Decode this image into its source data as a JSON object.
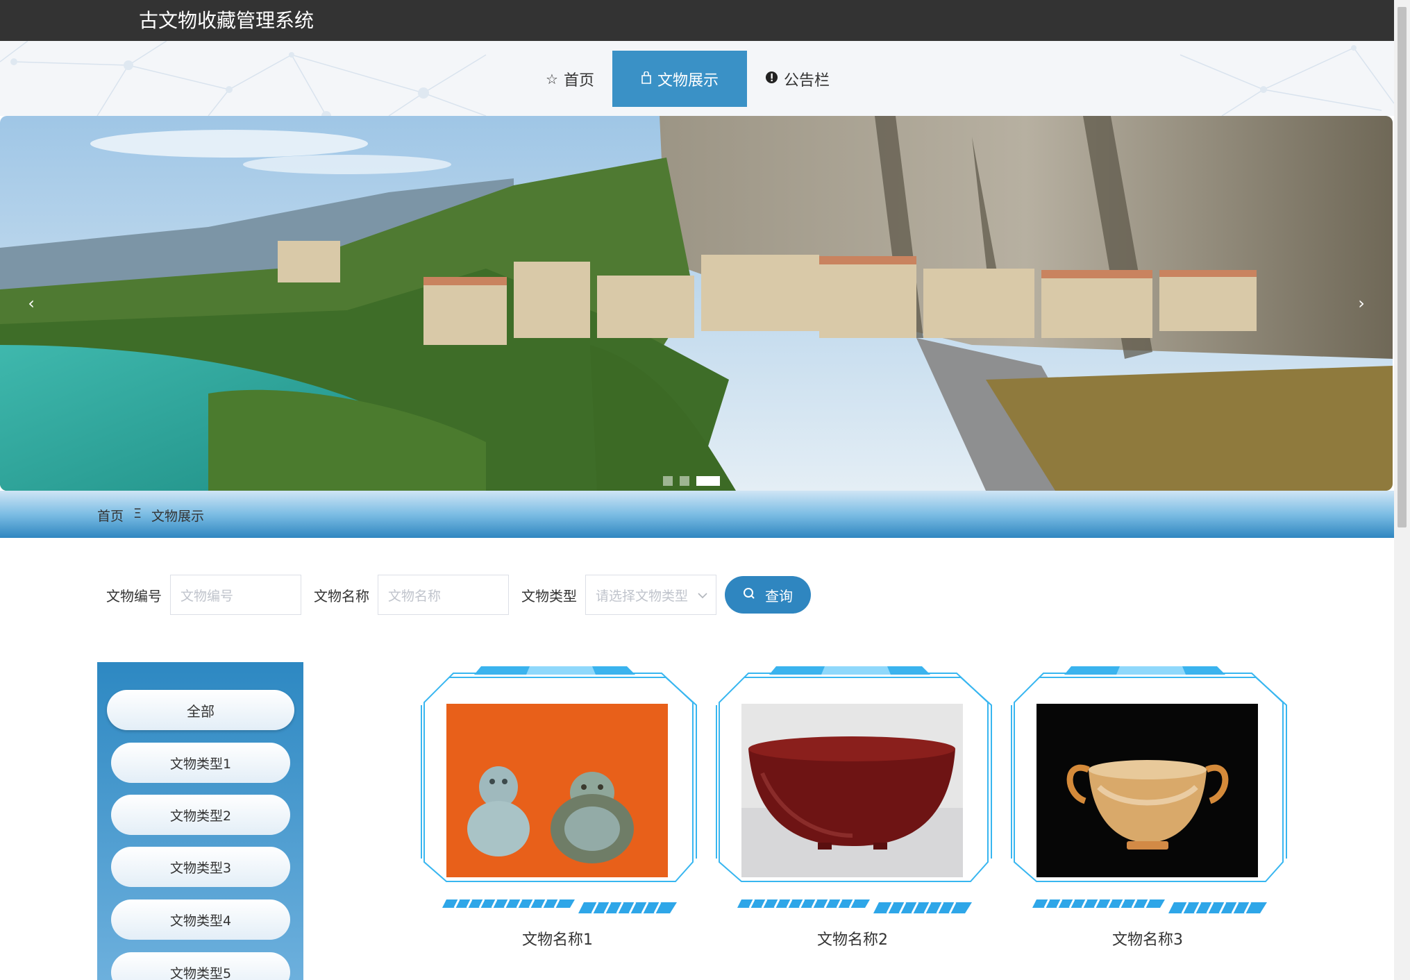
{
  "app": {
    "title": "古文物收藏管理系统"
  },
  "nav": {
    "items": [
      {
        "label": "首页",
        "icon": "star-icon"
      },
      {
        "label": "文物展示",
        "icon": "bag-icon",
        "active": true
      },
      {
        "label": "公告栏",
        "icon": "alert-icon"
      }
    ]
  },
  "carousel": {
    "slide_count": 3,
    "active_index": 2
  },
  "breadcrumb": {
    "home": "首页",
    "separator": "Ξ",
    "current": "文物展示"
  },
  "search": {
    "code_label": "文物编号",
    "code_placeholder": "文物编号",
    "name_label": "文物名称",
    "name_placeholder": "文物名称",
    "type_label": "文物类型",
    "type_placeholder": "请选择文物类型",
    "query_label": "查询"
  },
  "sidebar": {
    "items": [
      "全部",
      "文物类型1",
      "文物类型2",
      "文物类型3",
      "文物类型4",
      "文物类型5"
    ]
  },
  "cards": [
    {
      "name": "文物名称1"
    },
    {
      "name": "文物名称2"
    },
    {
      "name": "文物名称3"
    }
  ],
  "colors": {
    "accent": "#3a91c6",
    "topbar": "#333333"
  }
}
